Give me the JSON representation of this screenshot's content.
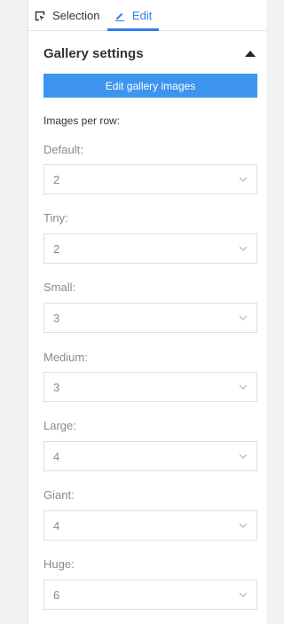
{
  "tabs": {
    "selection_label": "Selection",
    "edit_label": "Edit",
    "active": "Edit"
  },
  "section": {
    "title": "Gallery settings",
    "edit_button_label": "Edit gallery images",
    "images_per_row_label": "Images per row:"
  },
  "fields": [
    {
      "label": "Default:",
      "value": "2"
    },
    {
      "label": "Tiny:",
      "value": "2"
    },
    {
      "label": "Small:",
      "value": "3"
    },
    {
      "label": "Medium:",
      "value": "3"
    },
    {
      "label": "Large:",
      "value": "4"
    },
    {
      "label": "Giant:",
      "value": "4"
    },
    {
      "label": "Huge:",
      "value": "6"
    }
  ],
  "icons": {
    "selection": "selection-icon",
    "edit": "pencil-icon",
    "collapse": "caret-up-icon",
    "dropdown": "chevron-down-icon"
  },
  "colors": {
    "accent": "#2f80ed",
    "button": "#3d95ef",
    "muted_text": "#8a8a8a"
  }
}
